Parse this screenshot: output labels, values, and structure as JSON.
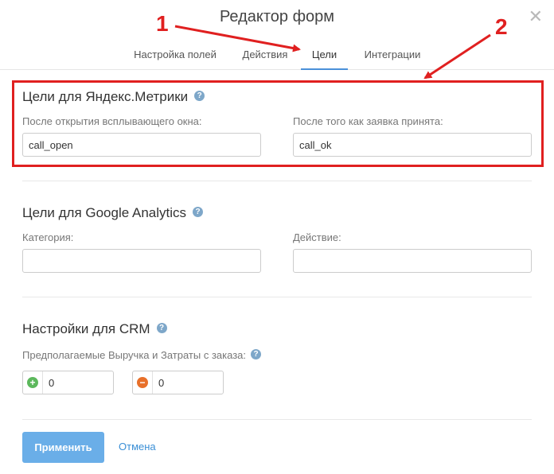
{
  "header": {
    "title": "Редактор форм",
    "close_icon": "close-icon",
    "tabs": [
      {
        "label": "Настройка полей",
        "active": false
      },
      {
        "label": "Действия",
        "active": false
      },
      {
        "label": "Цели",
        "active": true
      },
      {
        "label": "Интеграции",
        "active": false
      }
    ]
  },
  "annotations": [
    "1",
    "2"
  ],
  "yandex": {
    "title": "Цели для Яндекс.Метрики",
    "left_label": "После открытия всплывающего окна:",
    "left_value": "call_open",
    "right_label": "После того как заявка принята:",
    "right_value": "call_ok"
  },
  "google": {
    "title": "Цели для Google Analytics",
    "left_label": "Категория:",
    "left_value": "",
    "right_label": "Действие:",
    "right_value": ""
  },
  "crm": {
    "title": "Настройки для CRM",
    "label": "Предполагаемые Выручка и Затраты с заказа:",
    "revenue_value": "0",
    "cost_value": "0"
  },
  "footer": {
    "apply_label": "Применить",
    "cancel_label": "Отмена"
  },
  "colors": {
    "accent": "#4a90d9",
    "apply_button": "#6aaee8",
    "annotation_red": "#e02020",
    "plus_icon": "#5cb85c",
    "minus_icon": "#e8702a"
  }
}
